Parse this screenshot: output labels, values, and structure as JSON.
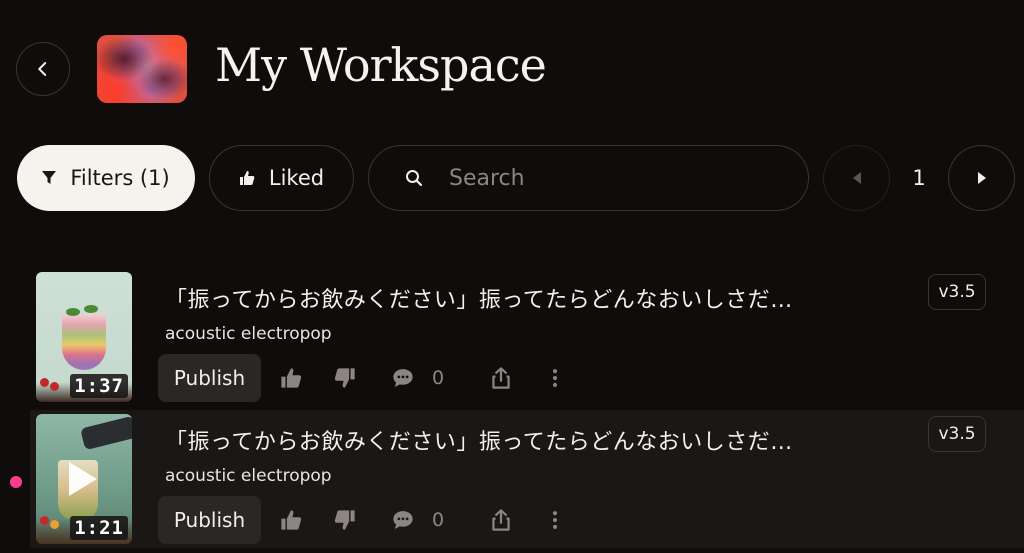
{
  "header": {
    "title": "My Workspace",
    "back_icon": "chevron-left-icon",
    "cover_colors": [
      "#e84838",
      "#b070b8",
      "#5a1e2a"
    ]
  },
  "toolbar": {
    "filters_label": "Filters (1)",
    "liked_label": "Liked",
    "search_placeholder": "Search",
    "search_value": "",
    "page_number": "1"
  },
  "colors": {
    "background": "#100c0c",
    "accent_dot": "#ff3d8b",
    "filters_bg": "#f6f2ee"
  },
  "songs": [
    {
      "title": "「振ってからお飲みください」振ってたらどんなおいしさだ…",
      "style": "acoustic electropop",
      "duration": "1:37",
      "version": "v3.5",
      "publish_label": "Publish",
      "comment_count": "0",
      "playing": false
    },
    {
      "title": "「振ってからお飲みください」振ってたらどんなおいしさだ…",
      "style": "acoustic electropop",
      "duration": "1:21",
      "version": "v3.5",
      "publish_label": "Publish",
      "comment_count": "0",
      "playing": true
    }
  ]
}
